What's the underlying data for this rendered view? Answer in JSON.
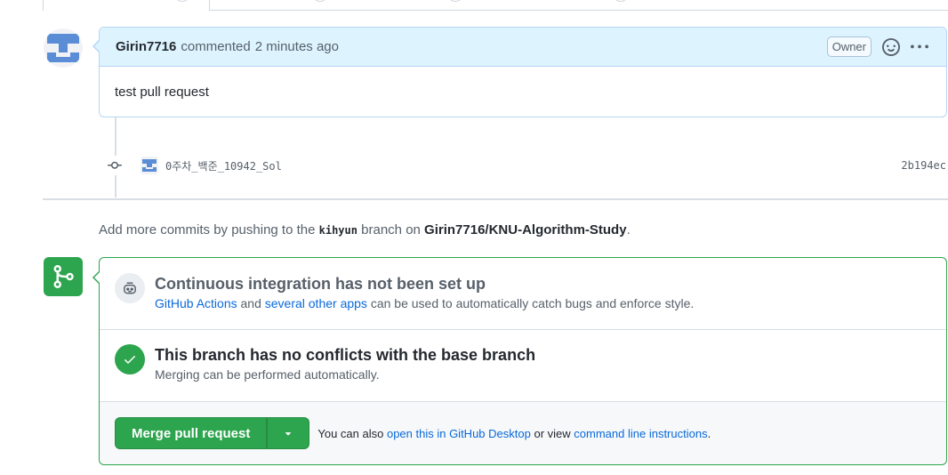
{
  "comment": {
    "author": "Girin7716",
    "action": "commented",
    "time": "2 minutes ago",
    "badge": "Owner",
    "body": "test pull request"
  },
  "commit": {
    "message": "0주차_백준_10942_Sol",
    "sha": "2b194ec"
  },
  "add_commits": {
    "prefix": "Add more commits by pushing to the",
    "branch": "kihyun",
    "middle": "branch on",
    "repo": "Girin7716/KNU-Algorithm-Study",
    "suffix": "."
  },
  "ci": {
    "title": "Continuous integration has not been set up",
    "link1": "GitHub Actions",
    "and": "and",
    "link2": "several other apps",
    "rest": "can be used to automatically catch bugs and enforce style."
  },
  "conflicts": {
    "title": "This branch has no conflicts with the base branch",
    "desc": "Merging can be performed automatically."
  },
  "merge": {
    "button": "Merge pull request",
    "note_prefix": "You can also",
    "link1": "open this in GitHub Desktop",
    "note_middle": "or view",
    "link2": "command line instructions",
    "note_suffix": "."
  },
  "colors": {
    "accent_green": "#2da44e",
    "link_blue": "#0969da",
    "header_blue": "#ddf4ff"
  },
  "icons": {
    "merge_section": "git-merge-icon",
    "ci": "robot-icon",
    "conflicts": "check-icon",
    "commit": "git-commit-icon",
    "reaction": "smiley-icon",
    "menu": "kebab-horizontal-icon",
    "dropdown": "triangle-down-icon"
  }
}
